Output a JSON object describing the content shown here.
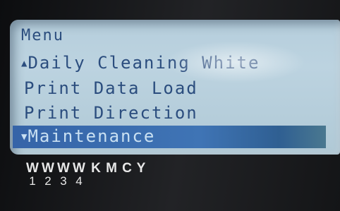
{
  "menu": {
    "title": "Menu",
    "items": [
      {
        "label": "Daily Cleaning White",
        "marker": "▲"
      },
      {
        "label": "Print Data Load",
        "marker": ""
      },
      {
        "label": "Print Direction",
        "marker": ""
      },
      {
        "label": "Maintenance",
        "marker": "▼",
        "selected": true
      }
    ]
  },
  "inks": [
    {
      "letter": "W",
      "number": "1"
    },
    {
      "letter": "W",
      "number": "2"
    },
    {
      "letter": "W",
      "number": "3"
    },
    {
      "letter": "W",
      "number": "4"
    },
    {
      "letter": "K",
      "number": ""
    },
    {
      "letter": "M",
      "number": ""
    },
    {
      "letter": "C",
      "number": ""
    },
    {
      "letter": "Y",
      "number": ""
    }
  ],
  "colors": {
    "lcd_background": "#b6cedc",
    "lcd_text": "#2b4d7e",
    "selection_background": "#3564a8",
    "selection_text": "#c9e0f2",
    "panel_label_text": "#e8e8e8"
  }
}
